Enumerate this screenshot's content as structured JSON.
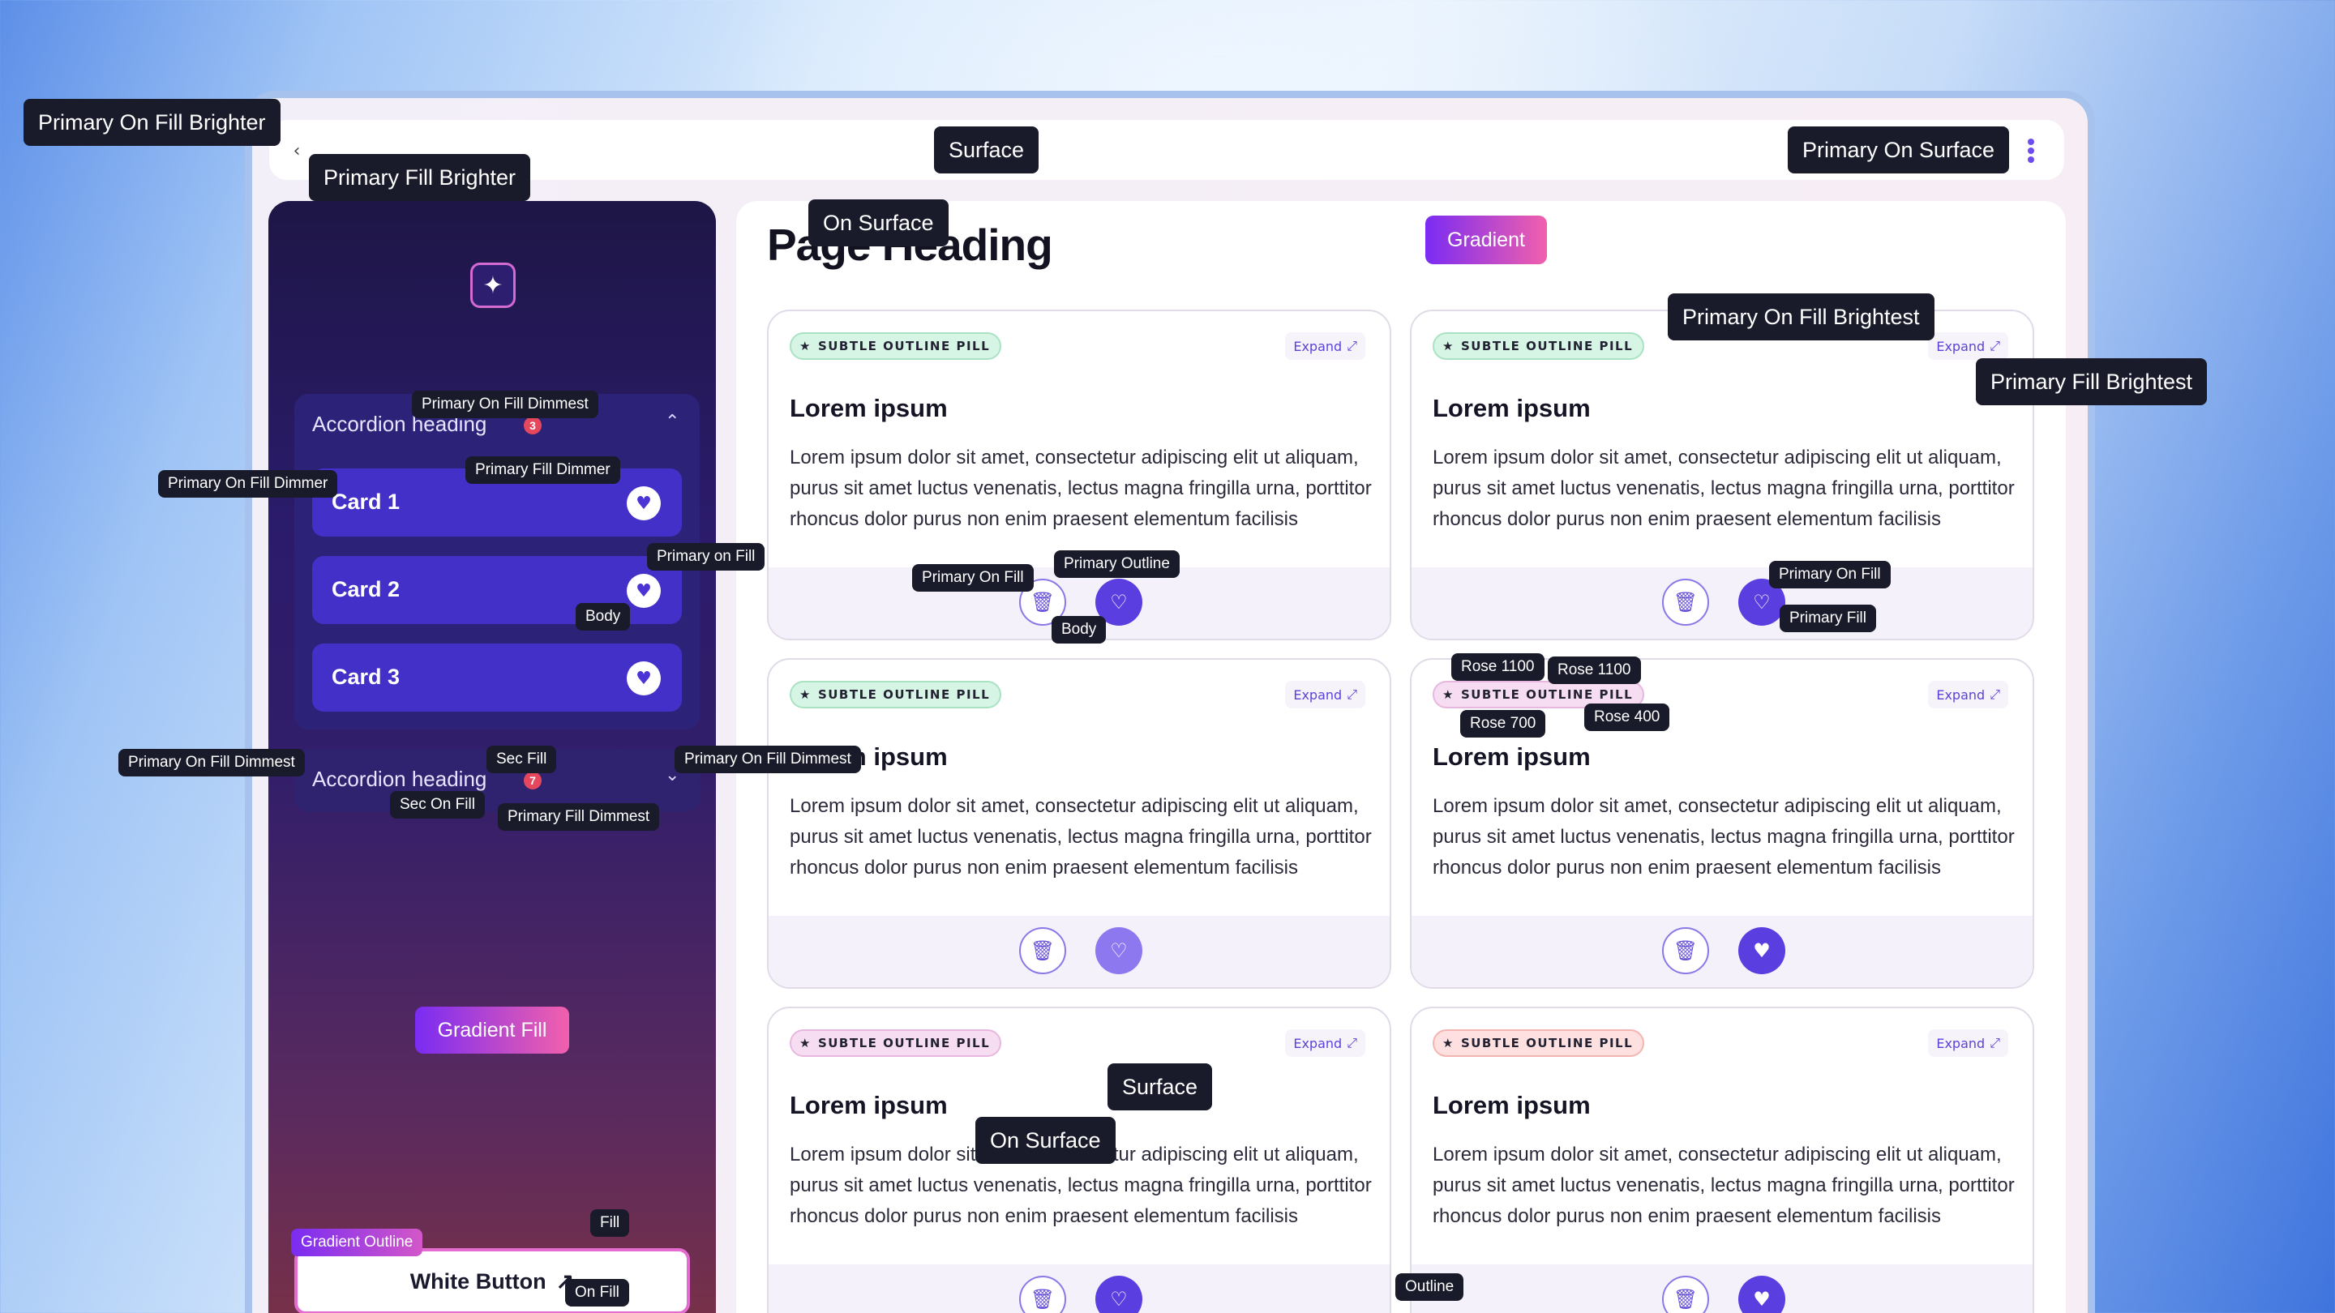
{
  "topbar": {
    "back_icon": "chevron-left-icon",
    "menu_icon": "kebab-icon"
  },
  "sidebar": {
    "logo_glyph": "✦",
    "accordions": [
      {
        "heading": "Accordion heading",
        "badge": "3",
        "expanded": true
      },
      {
        "heading": "Accordion heading",
        "badge": "7",
        "expanded": false
      }
    ],
    "cards": [
      {
        "label": "Card 1"
      },
      {
        "label": "Card 2"
      },
      {
        "label": "Card 3"
      }
    ],
    "gradient_fill_label": "Gradient Fill",
    "white_button_label": "White Button",
    "white_button_icon": "↗"
  },
  "main": {
    "page_heading": "Page Heading",
    "gradient_label": "Gradient",
    "cards": [
      {
        "pill": "SUBTLE OUTLINE PILL",
        "pill_color": "#d7f5e4",
        "expand": "Expand",
        "title": "Lorem ipsum",
        "body": "Lorem ipsum dolor sit amet, consectetur adipiscing elit ut aliquam, purus sit amet luctus venenatis, lectus magna fringilla urna, porttitor rhoncus dolor purus non enim praesent elementum facilisis"
      },
      {
        "pill": "SUBTLE OUTLINE PILL",
        "pill_color": "#d7f5e4",
        "expand": "Expand",
        "title": "Lorem ipsum",
        "body": "Lorem ipsum dolor sit amet, consectetur adipiscing elit ut aliquam, purus sit amet luctus venenatis, lectus magna fringilla urna, porttitor rhoncus dolor purus non enim praesent elementum facilisis"
      },
      {
        "pill": "SUBTLE OUTLINE PILL",
        "pill_color": "#d7f5e4",
        "expand": "Expand",
        "title": "Lorem ipsum",
        "body": "Lorem ipsum dolor sit amet, consectetur adipiscing elit ut aliquam, purus sit amet luctus venenatis, lectus magna fringilla urna, porttitor rhoncus dolor purus non enim praesent elementum facilisis"
      },
      {
        "pill": "SUBTLE OUTLINE PILL",
        "pill_color": "#f6ddf1",
        "expand": "Expand",
        "title": "Lorem ipsum",
        "body": "Lorem ipsum dolor sit amet, consectetur adipiscing elit ut aliquam, purus sit amet luctus venenatis, lectus magna fringilla urna, porttitor rhoncus dolor purus non enim praesent elementum facilisis"
      },
      {
        "pill": "SUBTLE OUTLINE PILL",
        "pill_color": "#f6ddf1",
        "expand": "Expand",
        "title": "Lorem ipsum",
        "body": "Lorem ipsum dolor sit amet, consectetur adipiscing elit ut aliquam, purus sit amet luctus venenatis, lectus magna fringilla urna, porttitor rhoncus dolor purus non enim praesent elementum facilisis"
      },
      {
        "pill": "SUBTLE OUTLINE PILL",
        "pill_color": "#fde0df",
        "expand": "Expand",
        "title": "Lorem ipsum",
        "body": "Lorem ipsum dolor sit amet, consectetur adipiscing elit ut aliquam, purus sit amet luctus venenatis, lectus magna fringilla urna, porttitor rhoncus dolor purus non enim praesent elementum facilisis"
      }
    ]
  },
  "tooltips": {
    "primary_on_fill_brighter": "Primary On Fill Brighter",
    "primary_fill_brighter": "Primary Fill Brighter",
    "surface_top": "Surface",
    "primary_on_surface": "Primary On Surface",
    "on_surface_top": "On Surface",
    "primary_on_fill_brightest": "Primary On Fill Brightest",
    "primary_fill_brightest": "Primary Fill Brightest",
    "primary_on_fill_dimmest_1": "Primary On Fill Dimmest",
    "primary_fill_dimmer": "Primary Fill Dimmer",
    "primary_on_fill_dimmer": "Primary On Fill Dimmer",
    "primary_on_fill_sidebar": "Primary on Fill",
    "body_sidebar": "Body",
    "primary_on_fill_dimmest_2": "Primary On Fill Dimmest",
    "sec_fill": "Sec Fill",
    "primary_on_fill_dimmest_3": "Primary On Fill Dimmest",
    "sec_on_fill": "Sec On Fill",
    "primary_fill_dimmest": "Primary Fill Dimmest",
    "primary_on_fill_card": "Primary On Fill",
    "primary_outline": "Primary Outline",
    "body_card": "Body",
    "primary_on_fill_card2": "Primary On Fill",
    "primary_fill_card2": "Primary Fill",
    "rose_1100_a": "Rose 1100",
    "rose_1100_b": "Rose 1100",
    "rose_700": "Rose 700",
    "rose_400": "Rose 400",
    "surface_bottom": "Surface",
    "on_surface_bottom": "On Surface",
    "outline": "Outline",
    "gradient_outline": "Gradient Outline",
    "fill": "Fill",
    "on_fill": "On Fill"
  }
}
